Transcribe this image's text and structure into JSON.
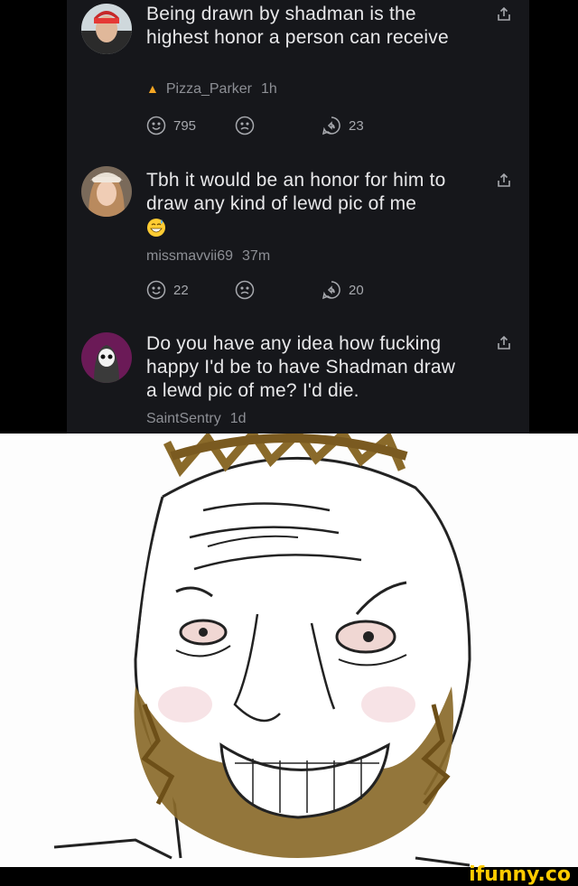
{
  "comments": [
    {
      "text": "Being drawn by shadman is the highest honor a person can receive",
      "username": "Pizza_Parker",
      "time": "1h",
      "flair": "fire-icon",
      "upvotes": "795",
      "replies": "23"
    },
    {
      "text": "Tbh it would be an honor for him to draw any kind of lewd pic of me",
      "username": "missmavvii69",
      "time": "37m",
      "emoji": "grinning-sweat-emoji",
      "upvotes": "22",
      "replies": "20"
    },
    {
      "text": "Do you have any idea how fucking happy I'd be to have Shadman draw a lewd pic of me? I'd die.",
      "username": "SaintSentry",
      "time": "1d"
    }
  ],
  "watermark": "ifunny.co",
  "colors": {
    "panel": "#16171b",
    "text": "#e8e8ea",
    "muted": "#8d8f95",
    "brand": "#ffcc00",
    "beard": "#8a6a2a"
  },
  "meme": {
    "description_icon": "bearded-wojak-illustration"
  }
}
